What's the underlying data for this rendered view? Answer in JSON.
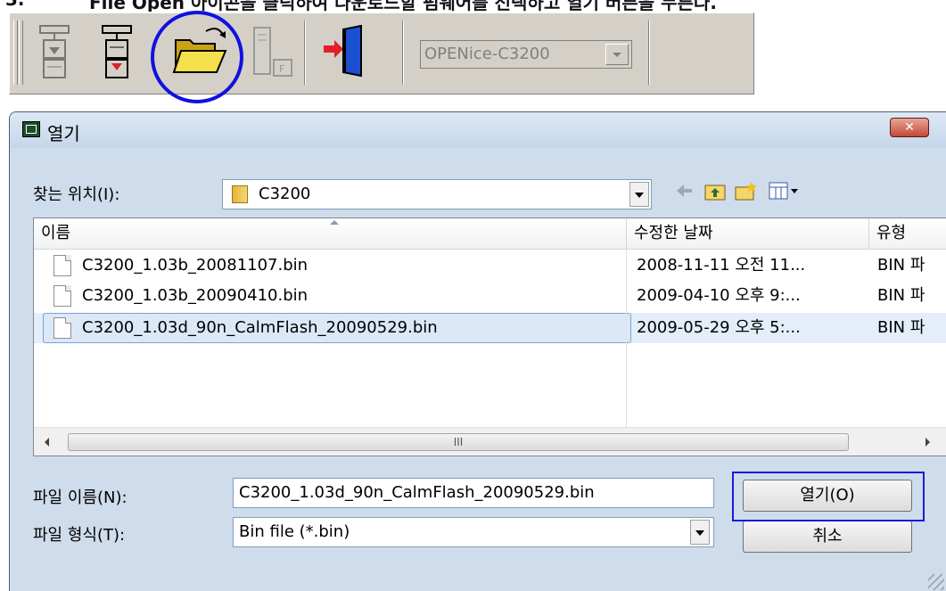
{
  "caption": {
    "number": "3.",
    "text": "File Open 아이콘을 클릭하여 다운로드할 펌웨어를 선택하고 열기 버튼을 누른다."
  },
  "toolbar": {
    "combo_value": "OPENice-C3200",
    "buttons": [
      "download-target-icon",
      "upload-target-icon",
      "file-open-icon",
      "flash-file-icon",
      "exit-icon"
    ],
    "highlight_color": "#1010e0"
  },
  "dialog": {
    "title": "열기",
    "close_label": "✕",
    "look_in_label": "찾는 위치(I):",
    "look_in_value": "C3200",
    "columns": {
      "name": "이름",
      "date": "수정한 날짜",
      "type": "유형"
    },
    "files": [
      {
        "name": "C3200_1.03b_20081107.bin",
        "date": "2008-11-11 오전 11...",
        "type": "BIN 파",
        "selected": false
      },
      {
        "name": "C3200_1.03b_20090410.bin",
        "date": "2009-04-10 오후 9:...",
        "type": "BIN 파",
        "selected": false
      },
      {
        "name": "C3200_1.03d_90n_CalmFlash_20090529.bin",
        "date": "2009-05-29 오후 5:...",
        "type": "BIN 파",
        "selected": true
      }
    ],
    "scroll_thumb_mark": "III",
    "file_name_label": "파일 이름(N):",
    "file_name_value": "C3200_1.03d_90n_CalmFlash_20090529.bin",
    "file_type_label": "파일 형식(T):",
    "file_type_value": "Bin file (*.bin)",
    "open_button": "열기(O)",
    "cancel_button": "취소",
    "highlight_color": "#1a1ad8"
  }
}
